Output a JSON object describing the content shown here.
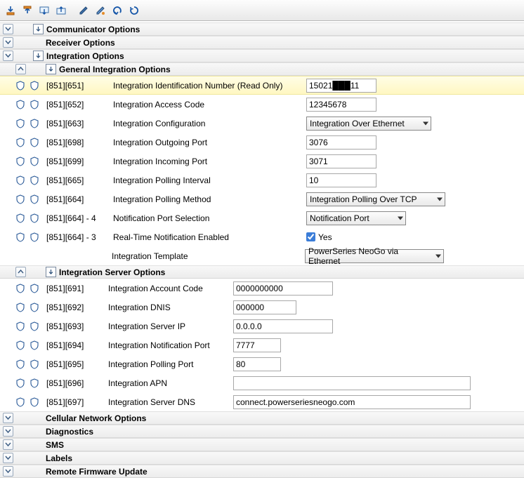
{
  "sections": {
    "communicator": "Communicator Options",
    "receiver": "Receiver Options",
    "integration": "Integration Options",
    "general_integration": "General Integration Options",
    "server_integration": "Integration Server Options",
    "cellular": "Cellular Network Options",
    "diagnostics": "Diagnostics",
    "sms": "SMS",
    "labels": "Labels",
    "firmware": "Remote Firmware Update"
  },
  "general": {
    "items": [
      {
        "code": "[851][651]",
        "label": "Integration Identification Number (Read Only)",
        "value": "15021███11",
        "type": "text",
        "readonly": true,
        "highlight": true,
        "width": "w100"
      },
      {
        "code": "[851][652]",
        "label": "Integration Access Code",
        "value": "12345678",
        "type": "text",
        "width": "w100"
      },
      {
        "code": "[851][663]",
        "label": "Integration Configuration",
        "value": "Integration Over Ethernet",
        "type": "select",
        "width": "w170"
      },
      {
        "code": "[851][698]",
        "label": "Integration Outgoing Port",
        "value": "3076",
        "type": "text",
        "width": "w100"
      },
      {
        "code": "[851][699]",
        "label": "Integration Incoming Port",
        "value": "3071",
        "type": "text",
        "width": "w100"
      },
      {
        "code": "[851][665]",
        "label": "Integration Polling Interval",
        "value": "10",
        "type": "text",
        "width": "w100"
      },
      {
        "code": "[851][664]",
        "label": "Integration Polling Method",
        "value": "Integration Polling Over TCP",
        "type": "select",
        "width": "w195"
      },
      {
        "code": "[851][664] - 4",
        "label": "Notification Port Selection",
        "value": "Notification Port",
        "type": "select",
        "width": "w140"
      },
      {
        "code": "[851][664] - 3",
        "label": "Real-Time Notification Enabled",
        "value": "Yes",
        "type": "checkbox",
        "checked": true
      },
      {
        "code": "",
        "label": "Integration Template",
        "value": "PowerSeries NeoGo via Ethernet",
        "type": "select",
        "width": "w195",
        "noshields": true
      }
    ]
  },
  "server": {
    "items": [
      {
        "code": "[851][691]",
        "label": "Integration Account Code",
        "value": "0000000000",
        "type": "text",
        "width": "w140"
      },
      {
        "code": "[851][692]",
        "label": "Integration DNIS",
        "value": "000000",
        "type": "text",
        "width": "w90"
      },
      {
        "code": "[851][693]",
        "label": "Integration Server IP",
        "value": "0.0.0.0",
        "type": "text",
        "width": "w140"
      },
      {
        "code": "[851][694]",
        "label": "Integration Notification Port",
        "value": "7777",
        "type": "text",
        "width": "w68"
      },
      {
        "code": "[851][695]",
        "label": "Integration Polling Port",
        "value": "80",
        "type": "text",
        "width": "w68"
      },
      {
        "code": "[851][696]",
        "label": "Integration APN",
        "value": "",
        "type": "text",
        "width": "w330"
      },
      {
        "code": "[851][697]",
        "label": "Integration Server DNS",
        "value": "connect.powerseriesneogo.com",
        "type": "text",
        "width": "w330"
      }
    ]
  },
  "icons": {
    "expand_down": "expand-down-icon",
    "expand_up": "expand-up-icon"
  }
}
